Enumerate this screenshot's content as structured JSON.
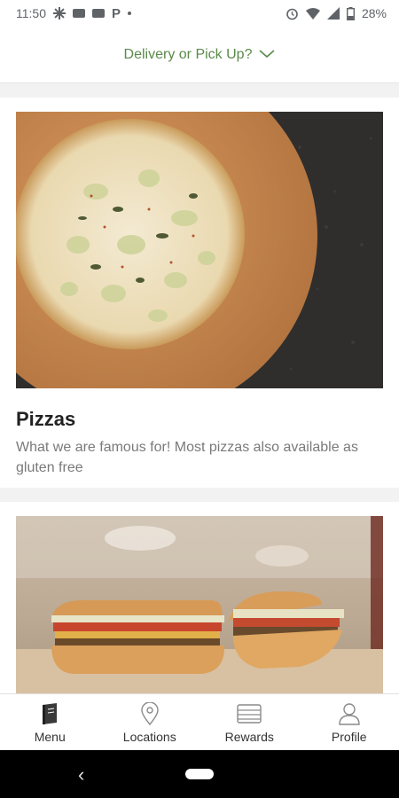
{
  "status_bar": {
    "time": "11:50",
    "battery": "28%"
  },
  "header": {
    "label": "Delivery or Pick Up?",
    "accent_color": "#5a8a4a"
  },
  "cards": [
    {
      "title": "Pizzas",
      "description": "What we are famous for! Most pizzas also available as gluten free",
      "image_subject": "artichoke-pizza-on-wooden-board"
    },
    {
      "title": "",
      "description": "",
      "image_subject": "sandwich-halves-on-board"
    }
  ],
  "bottom_nav": {
    "items": [
      {
        "label": "Menu",
        "icon": "menu-book-icon"
      },
      {
        "label": "Locations",
        "icon": "location-pin-icon"
      },
      {
        "label": "Rewards",
        "icon": "rewards-icon"
      },
      {
        "label": "Profile",
        "icon": "profile-icon"
      }
    ]
  }
}
